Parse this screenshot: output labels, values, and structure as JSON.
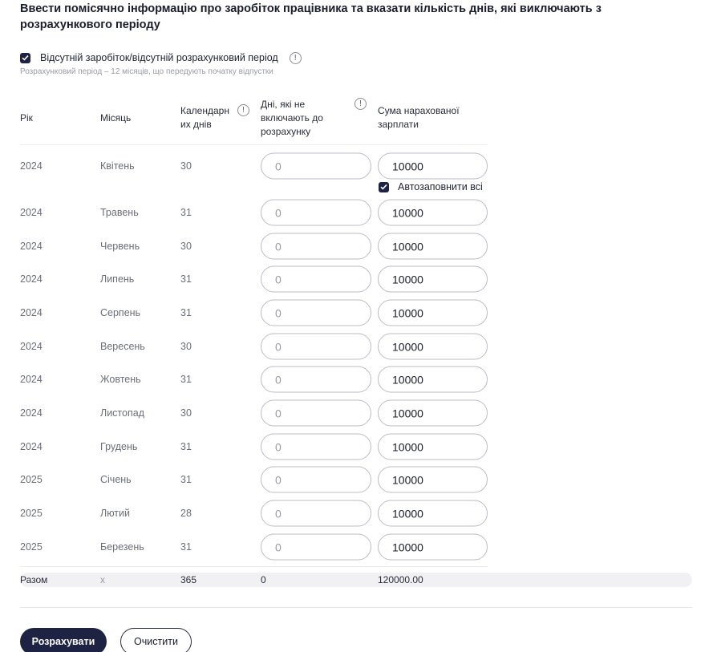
{
  "title": "Ввести помісячно інформацію про заробіток працівника та вказати кількість днів, які виключають з розрахункового періоду",
  "absent_checkbox": {
    "label": "Відсутній заробіток/відсутній розрахунковий період",
    "checked": true
  },
  "hint": "Розрахунковий період – 12 місяців, що передують початку відпустки",
  "columns": {
    "year": "Рік",
    "month": "Місяць",
    "calendar_days_line1": "Календарн",
    "calendar_days_line2": "их днів",
    "excluded_line1": "Дні, які не",
    "excluded_line2": "включають до",
    "excluded_line3": "розрахунку",
    "salary_line1": "Сума нарахованої",
    "salary_line2": "зарплати"
  },
  "info_glyph": "!",
  "autofill": {
    "label": "Автозаповнити всі",
    "checked": true
  },
  "rows": [
    {
      "year": "2024",
      "month": "Квітень",
      "days": "30",
      "excluded": "0",
      "salary": "10000"
    },
    {
      "year": "2024",
      "month": "Травень",
      "days": "31",
      "excluded": "0",
      "salary": "10000"
    },
    {
      "year": "2024",
      "month": "Червень",
      "days": "30",
      "excluded": "0",
      "salary": "10000"
    },
    {
      "year": "2024",
      "month": "Липень",
      "days": "31",
      "excluded": "0",
      "salary": "10000"
    },
    {
      "year": "2024",
      "month": "Серпень",
      "days": "31",
      "excluded": "0",
      "salary": "10000"
    },
    {
      "year": "2024",
      "month": "Вересень",
      "days": "30",
      "excluded": "0",
      "salary": "10000"
    },
    {
      "year": "2024",
      "month": "Жовтень",
      "days": "31",
      "excluded": "0",
      "salary": "10000"
    },
    {
      "year": "2024",
      "month": "Листопад",
      "days": "30",
      "excluded": "0",
      "salary": "10000"
    },
    {
      "year": "2024",
      "month": "Грудень",
      "days": "31",
      "excluded": "0",
      "salary": "10000"
    },
    {
      "year": "2025",
      "month": "Січень",
      "days": "31",
      "excluded": "0",
      "salary": "10000"
    },
    {
      "year": "2025",
      "month": "Лютий",
      "days": "28",
      "excluded": "0",
      "salary": "10000"
    },
    {
      "year": "2025",
      "month": "Березень",
      "days": "31",
      "excluded": "0",
      "salary": "10000"
    }
  ],
  "totals": {
    "label": "Разом",
    "month": "x",
    "days": "365",
    "excluded": "0",
    "salary": "120000.00"
  },
  "buttons": {
    "calculate": "Розрахувати",
    "clear": "Очистити"
  },
  "colors": {
    "primary": "#1e2344",
    "field_border": "#b9bcc5",
    "muted_text": "#6b6e78",
    "total_bar": "#f1f1f4"
  }
}
